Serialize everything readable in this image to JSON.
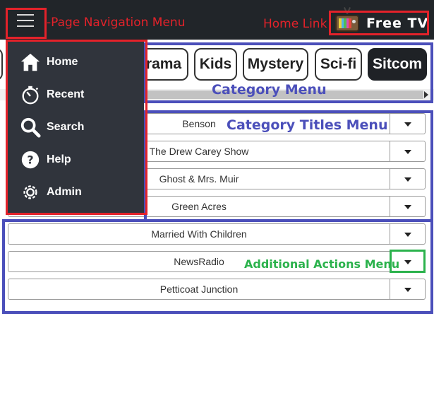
{
  "header": {
    "menu_button_name": "hamburger-menu",
    "brand_label": "Free TV"
  },
  "categories": [
    {
      "label": "rama"
    },
    {
      "label": "Kids"
    },
    {
      "label": "Mystery"
    },
    {
      "label": "Sci-fi"
    },
    {
      "label": "Sitcom",
      "active": true
    }
  ],
  "titles": [
    {
      "label": "Benson"
    },
    {
      "label": "The Drew Carey Show"
    },
    {
      "label": "Ghost & Mrs. Muir"
    },
    {
      "label": "Green Acres"
    },
    {
      "label": "Married With Children"
    },
    {
      "label": "NewsRadio"
    },
    {
      "label": "Petticoat Junction"
    }
  ],
  "nav": {
    "items": [
      {
        "label": "Home",
        "icon": "home-icon"
      },
      {
        "label": "Recent",
        "icon": "stopwatch-icon"
      },
      {
        "label": "Search",
        "icon": "search-icon"
      },
      {
        "label": "Help",
        "icon": "help-icon"
      },
      {
        "label": "Admin",
        "icon": "gear-icon"
      }
    ]
  },
  "annotations": {
    "page_nav": "-Page Navigation Menu",
    "home_link": "Home Link",
    "category_menu": "Category Menu",
    "category_titles_menu": "Category Titles Menu",
    "additional_actions_menu": "Additional Actions Menu"
  },
  "colors": {
    "annotation_red": "#e3222a",
    "annotation_blue": "#4b4fba",
    "annotation_green": "#2bb24c",
    "navbar": "#212529",
    "sidenav": "#30343c"
  }
}
